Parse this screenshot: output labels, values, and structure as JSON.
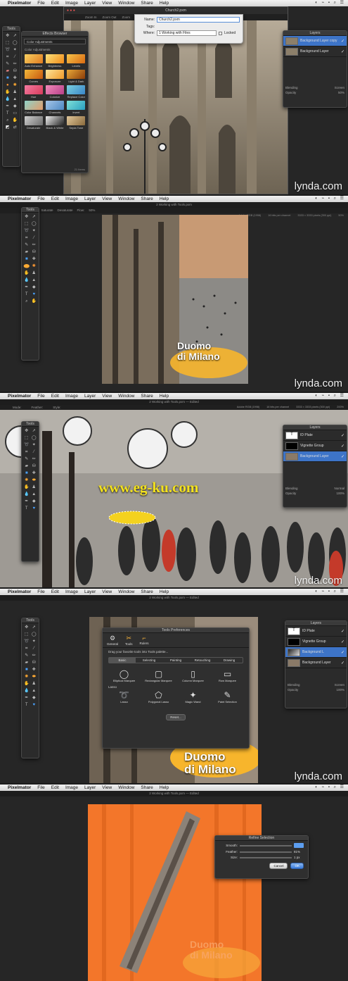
{
  "menubar": {
    "app": "Pixelmator",
    "items": [
      "File",
      "Edit",
      "Image",
      "Layer",
      "View",
      "Window",
      "Share",
      "Help"
    ]
  },
  "watermark": "lynda.com",
  "overlay_watermark": "www.eg-ku.com",
  "colors": {
    "accent": "#3d74c8",
    "orange": "#f3762a",
    "yellow": "#f4d21e"
  },
  "frame1": {
    "window_title": "Church2.pxm",
    "save_sheet": {
      "name_label": "Name:",
      "name_value": "Church2.pxm",
      "tags_label": "Tags:",
      "where_label": "Where:",
      "where_value": "1 Working with Files",
      "locked_label": "Locked"
    },
    "toolbar_items": [
      "Zoom In",
      "Zoom Out",
      "Zoom"
    ],
    "tools_title": "Tools",
    "effects": {
      "title": "Effects Browser",
      "dropdown": "Color Adjustments",
      "section": "Color Adjustments",
      "items": [
        "Auto Enhance",
        "Brightness",
        "Levels",
        "Curves",
        "Exposure",
        "Light & Dark",
        "Hue",
        "Colorize",
        "Replace Color",
        "Color Balance",
        "Channels",
        "Invert",
        "Desaturate",
        "Black & White",
        "Sepia Tone"
      ],
      "footer": "21 Items"
    },
    "layers": {
      "title": "Layers",
      "items": [
        "Background Layer copy",
        "Background Layer"
      ],
      "blending_label": "Blending",
      "blending_value": "Screen",
      "opacity_label": "Opacity",
      "opacity_value": "50%"
    }
  },
  "frame2": {
    "window_title": "2 Working with Tools.pxm",
    "toolbar_items": [
      "Mode:",
      "Saturate",
      "Desaturate",
      "Flow:",
      "50%"
    ],
    "status": [
      "Adobe RGB (1998)",
      "16 bits per channel",
      "3333 × 3333 pixels (300 ppi)",
      "50%"
    ],
    "tools_title": "Tools",
    "caption_line1": "Duomo",
    "caption_line2": "di Milano"
  },
  "frame3": {
    "window_title": "2 Working with Tools.pxm — Edited",
    "toolbar_items": [
      "Mode:",
      "Feather:",
      "Style:"
    ],
    "status": [
      "Adobe RGB (1998)",
      "16 bits per channel",
      "3333 × 3333 pixels (300 ppi)",
      "200%"
    ],
    "tools_title": "Tools",
    "layers": {
      "title": "Layers",
      "items": [
        "ID Plate",
        "Vignette Group",
        "Background Layer"
      ],
      "blending_label": "Blending",
      "blending_value": "Normal",
      "opacity_label": "Opacity",
      "opacity_value": "100%"
    }
  },
  "frame4": {
    "window_title": "2 Working with Tools.pxm — Edited",
    "tools_title": "Tools",
    "prefs": {
      "title": "Tools Preferences",
      "tabs": [
        "General",
        "Tools",
        "Rulers"
      ],
      "instruction": "Drag your favorite tools into Tools palette...",
      "segments": [
        "Basic",
        "Selecting",
        "Painting",
        "Retouching",
        "Drawing"
      ],
      "tools_row1": [
        "Elliptical Marquee",
        "Rectangular Marquee",
        "Column Marquee",
        "Row Marquee"
      ],
      "lasso_label": "Lasso",
      "tools_row2": [
        "Lasso",
        "Polygonal Lasso",
        "Magic Wand",
        "Paint Selection"
      ],
      "reset": "Reset..."
    },
    "layers": {
      "title": "Layers",
      "items": [
        "ID Plate",
        "Vignette Group",
        "Background L",
        "Background Layer"
      ],
      "blending_label": "Blending",
      "blending_value": "Screen",
      "opacity_label": "Opacity",
      "opacity_value": "100%"
    },
    "caption_line1": "Duomo",
    "caption_line2": "di Milano"
  },
  "frame5": {
    "window_title": "2 Working with Tools.pxm — Edited",
    "refine": {
      "title": "Refine Selection",
      "rows": [
        {
          "label": "Smooth:",
          "value": ""
        },
        {
          "label": "Feather:",
          "value": "81%"
        },
        {
          "label": "Size:",
          "value": "1 px"
        }
      ],
      "cancel": "Cancel",
      "ok": "OK"
    },
    "caption_line1": "Duomo",
    "caption_line2": "di Milano"
  }
}
